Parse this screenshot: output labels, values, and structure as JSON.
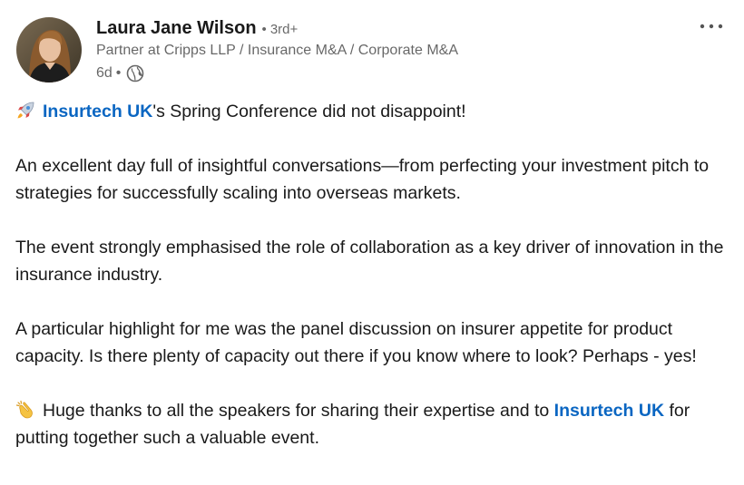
{
  "author": {
    "name": "Laura Jane Wilson",
    "separator": "•",
    "degree": "3rd+",
    "headline": "Partner at Cripps LLP / Insurance M&A / Corporate M&A",
    "age": "6d",
    "meta_separator": "•",
    "visibility_icon": "globe-icon"
  },
  "menu": {
    "icon": "more-options-icon"
  },
  "post": {
    "line1_mention": "Insurtech UK",
    "line1_text": "'s Spring Conference did not disappoint!",
    "line1_emoji": "rocket-emoji",
    "para2": "An excellent day full of insightful conversations—from perfecting your investment pitch to strategies for successfully scaling into overseas markets.",
    "para3": "The event strongly emphasised the role of collaboration as a key driver of innovation in the insurance industry.",
    "para4": "A particular highlight for me was the panel discussion on insurer appetite for product capacity. Is there plenty of capacity out there if you know where to look? Perhaps - yes!",
    "para5_emoji": "clapping-hands-emoji",
    "para5_text": "Huge thanks to all the speakers for sharing their expertise and to",
    "para5_mention": "Insurtech UK",
    "para5_tail": "for putting together such a valuable event."
  },
  "colors": {
    "link": "#0a66c2",
    "primary_text": "#191919",
    "secondary_text": "#666666"
  }
}
